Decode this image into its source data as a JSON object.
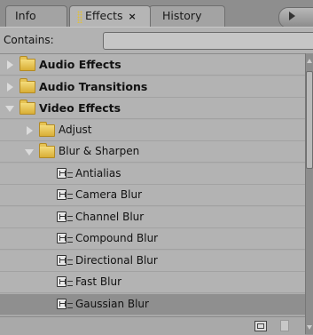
{
  "tabs": [
    {
      "label": "Info",
      "active": false
    },
    {
      "label": "Effects",
      "active": true,
      "close": "×"
    },
    {
      "label": "History",
      "active": false
    }
  ],
  "contains": {
    "label": "Contains:",
    "value": ""
  },
  "tree": [
    {
      "label": "Audio Effects",
      "level": 0,
      "type": "folder",
      "expanded": false,
      "bold": true
    },
    {
      "label": "Audio Transitions",
      "level": 0,
      "type": "folder",
      "expanded": false,
      "bold": true
    },
    {
      "label": "Video Effects",
      "level": 0,
      "type": "folder",
      "expanded": true,
      "bold": true
    },
    {
      "label": "Adjust",
      "level": 1,
      "type": "folder",
      "expanded": false
    },
    {
      "label": "Blur & Sharpen",
      "level": 1,
      "type": "folder",
      "expanded": true
    },
    {
      "label": "Antialias",
      "level": 2,
      "type": "effect"
    },
    {
      "label": "Camera Blur",
      "level": 2,
      "type": "effect"
    },
    {
      "label": "Channel Blur",
      "level": 2,
      "type": "effect"
    },
    {
      "label": "Compound Blur",
      "level": 2,
      "type": "effect"
    },
    {
      "label": "Directional Blur",
      "level": 2,
      "type": "effect"
    },
    {
      "label": "Fast Blur",
      "level": 2,
      "type": "effect"
    },
    {
      "label": "Gaussian Blur",
      "level": 2,
      "type": "effect",
      "selected": true
    }
  ],
  "icons": {
    "panel_menu": "flyout-menu-icon",
    "new_bin": "new-bin-icon",
    "delete": "trash-icon"
  }
}
